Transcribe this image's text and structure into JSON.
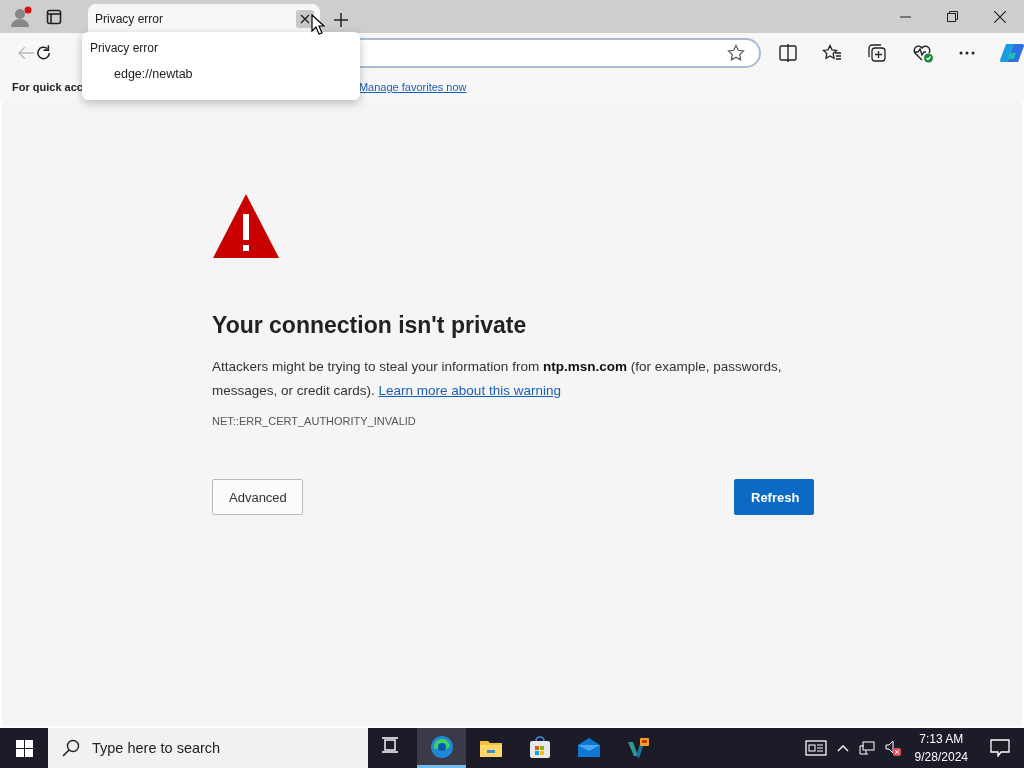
{
  "tabs": [
    {
      "title": "Privacy error",
      "selected": true
    }
  ],
  "tab_tooltip": {
    "title": "Privacy error",
    "url": "edge://newtab"
  },
  "favorites_bar": {
    "message": "For quick acc",
    "link": "Manage favorites now"
  },
  "error_page": {
    "heading": "Your connection isn't private",
    "description": "Attackers might be trying to steal your information from **ntp.msn.com** (for example, passwords, messages, or credit cards). ",
    "link": "Learn more about this warning",
    "error_code": "NET::ERR_CERT_AUTHORITY_INVALID",
    "buttons": [
      {
        "label": "Advanced",
        "kind": "secondary"
      },
      {
        "label": "Refresh",
        "kind": "primary"
      }
    ]
  },
  "taskbar": {
    "search": {
      "placeholder": "Type here to search"
    },
    "apps": [
      {
        "kind": "taskview",
        "active": false
      },
      {
        "kind": "edge",
        "active": true
      },
      {
        "kind": "files",
        "active": false
      },
      {
        "kind": "store",
        "active": false
      },
      {
        "kind": "mail",
        "active": false
      },
      {
        "kind": "vs",
        "active": false
      }
    ],
    "time": "7:13 AM",
    "date": "9/28/2024"
  }
}
